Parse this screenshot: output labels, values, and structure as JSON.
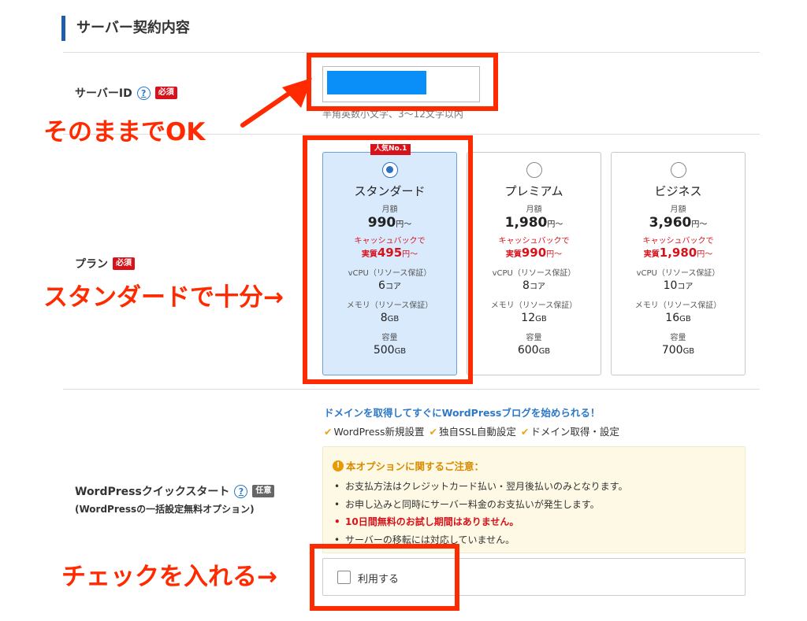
{
  "section_title": "サーバー契約内容",
  "server_id": {
    "label": "サーバーID",
    "help": "?",
    "required": "必須",
    "hint": "半角英数小文字、3〜12文字以内"
  },
  "plan": {
    "label": "プラン",
    "required": "必須",
    "popular_badge": "人気No.1",
    "monthly_label": "月額",
    "cashback_label": "キャッシュバックで",
    "real_label": "実質",
    "price_unit": "円〜",
    "vcpu_label": "vCPU（リソース保証）",
    "memory_label": "メモリ（リソース保証）",
    "storage_label": "容量",
    "core_unit": "コア",
    "gb_unit": "GB",
    "options": [
      {
        "name": "スタンダード",
        "price": "990",
        "real_price": "495",
        "vcpu": "6",
        "memory": "8",
        "storage": "500",
        "selected": true
      },
      {
        "name": "プレミアム",
        "price": "1,980",
        "real_price": "990",
        "vcpu": "8",
        "memory": "12",
        "storage": "600",
        "selected": false
      },
      {
        "name": "ビジネス",
        "price": "3,960",
        "real_price": "1,980",
        "vcpu": "10",
        "memory": "16",
        "storage": "700",
        "selected": false
      }
    ]
  },
  "wordpress": {
    "label": "WordPressクイックスタート",
    "help": "?",
    "optional": "任意",
    "sublabel": "(WordPressの一括設定無料オプション)",
    "headline": "ドメインを取得してすぐにWordPressブログを始められる！",
    "features": [
      "WordPress新規設置",
      "独自SSL自動設定",
      "ドメイン取得・設定"
    ],
    "check_glyph": "✔",
    "notice_icon": "!",
    "notice_title": "本オプションに関するご注意：",
    "notices": [
      "お支払方法はクレジットカード払い・翌月後払いのみとなります。",
      "お申し込みと同時にサーバー料金のお支払いが発生します。",
      "10日間無料のお試し期間はありません。",
      "サーバーの移転には対応していません。"
    ],
    "use_label": "利用する",
    "use_checked": false
  },
  "annotations": {
    "ok": "そのままでOK",
    "standard": "スタンダードで十分→",
    "check": "チェックを入れる→"
  },
  "colors": {
    "accent": "#1f5fa8",
    "annotation_red": "#ff2a00",
    "required_red": "#d8121b",
    "masked_field": "#0a8ef7",
    "selected_plan_bg": "#d9eafd"
  }
}
